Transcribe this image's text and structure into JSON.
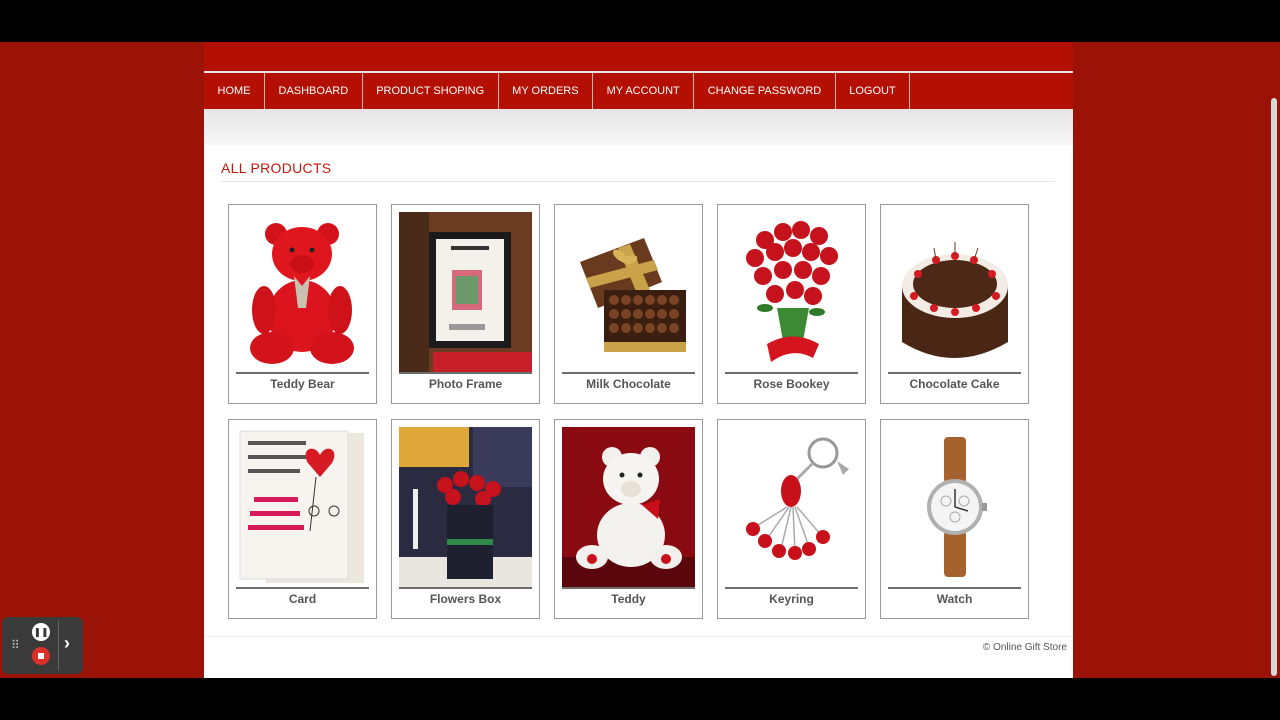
{
  "nav": {
    "items": [
      {
        "label": "HOME"
      },
      {
        "label": "DASHBOARD"
      },
      {
        "label": "PRODUCT SHOPING"
      },
      {
        "label": "MY ORDERS"
      },
      {
        "label": "MY ACCOUNT"
      },
      {
        "label": "CHANGE PASSWORD"
      },
      {
        "label": "LOGOUT"
      }
    ]
  },
  "section": {
    "title": "ALL PRODUCTS"
  },
  "products": [
    {
      "name": "Teddy Bear",
      "icon": "teddy-bear-image"
    },
    {
      "name": "Photo Frame",
      "icon": "photo-frame-image"
    },
    {
      "name": "Milk Chocolate",
      "icon": "chocolate-box-image"
    },
    {
      "name": "Rose Bookey",
      "icon": "rose-bouquet-image"
    },
    {
      "name": "Chocolate Cake",
      "icon": "cake-image"
    },
    {
      "name": "Card",
      "icon": "greeting-card-image"
    },
    {
      "name": "Flowers Box",
      "icon": "flower-box-image"
    },
    {
      "name": "Teddy",
      "icon": "white-teddy-image"
    },
    {
      "name": "Keyring",
      "icon": "keyring-image"
    },
    {
      "name": "Watch",
      "icon": "watch-image"
    }
  ],
  "footer": {
    "text": "© Online Gift Store"
  },
  "colors": {
    "brand": "#b30f03",
    "background": "#9b1207",
    "accent": "#c4190c"
  }
}
